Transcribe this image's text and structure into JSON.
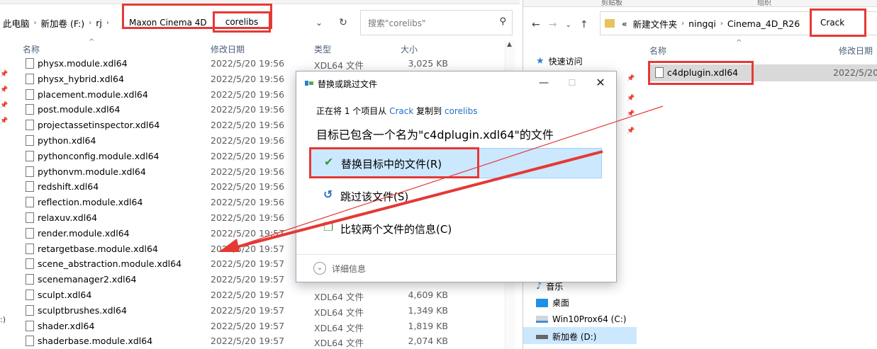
{
  "left_explorer": {
    "breadcrumb": [
      "此电脑",
      "新加卷 (F:)",
      "rj",
      "Maxon Cinema 4D",
      "corelibs"
    ],
    "search_placeholder": "搜索\"corelibs\"",
    "columns": {
      "name": "名称",
      "date": "修改日期",
      "type": "类型",
      "size": "大小"
    },
    "files": [
      {
        "name": "physx.module.xdl64",
        "date": "2022/5/20 19:56",
        "type": "XDL64 文件",
        "size": "3,025 KB"
      },
      {
        "name": "physx_hybrid.xdl64",
        "date": "2022/5/20 19:56",
        "type": "",
        "size": ""
      },
      {
        "name": "placement.module.xdl64",
        "date": "2022/5/20 19:56",
        "type": "",
        "size": ""
      },
      {
        "name": "post.module.xdl64",
        "date": "2022/5/20 19:56",
        "type": "",
        "size": ""
      },
      {
        "name": "projectassetinspector.xdl64",
        "date": "2022/5/20 19:56",
        "type": "",
        "size": ""
      },
      {
        "name": "python.xdl64",
        "date": "2022/5/20 19:56",
        "type": "",
        "size": ""
      },
      {
        "name": "pythonconfig.module.xdl64",
        "date": "2022/5/20 19:56",
        "type": "",
        "size": ""
      },
      {
        "name": "pythonvm.module.xdl64",
        "date": "2022/5/20 19:56",
        "type": "",
        "size": ""
      },
      {
        "name": "redshift.xdl64",
        "date": "2022/5/20 19:56",
        "type": "",
        "size": ""
      },
      {
        "name": "reflection.module.xdl64",
        "date": "2022/5/20 19:56",
        "type": "",
        "size": ""
      },
      {
        "name": "relaxuv.xdl64",
        "date": "2022/5/20 19:56",
        "type": "",
        "size": ""
      },
      {
        "name": "render.module.xdl64",
        "date": "2022/5/20 19:57",
        "type": "",
        "size": ""
      },
      {
        "name": "retargetbase.module.xdl64",
        "date": "2022/5/20 19:57",
        "type": "",
        "size": ""
      },
      {
        "name": "scene_abstraction.module.xdl64",
        "date": "2022/5/20 19:57",
        "type": "",
        "size": ""
      },
      {
        "name": "scenemanager2.xdl64",
        "date": "2022/5/20 19:57",
        "type": "",
        "size": ""
      },
      {
        "name": "sculpt.xdl64",
        "date": "2022/5/20 19:57",
        "type": "XDL64 文件",
        "size": "4,609 KB"
      },
      {
        "name": "sculptbrushes.xdl64",
        "date": "2022/5/20 19:57",
        "type": "XDL64 文件",
        "size": "1,349 KB"
      },
      {
        "name": "shader.xdl64",
        "date": "2022/5/20 19:57",
        "type": "XDL64 文件",
        "size": "1,819 KB"
      },
      {
        "name": "shaderbase.module.xdl64",
        "date": "2022/5/20 19:57",
        "type": "XDL64 文件",
        "size": "2,074 KB"
      }
    ],
    "edge_text": ":)"
  },
  "right_explorer": {
    "ribbon": [
      "剪贴板",
      "组织"
    ],
    "breadcrumb": [
      "«",
      "新建文件夹",
      "ningqi",
      "Cinema_4D_R26",
      "Crack"
    ],
    "columns": {
      "name": "名称",
      "date": "修改日期"
    },
    "nav": {
      "quick_access": "快速访问",
      "music": "音乐",
      "desktop": "桌面",
      "drive_c": "Win10Prox64 (C:)",
      "drive_d": "新加卷 (D:)"
    },
    "file": {
      "name": "c4dplugin.xdl64",
      "date": "2022/5/20"
    }
  },
  "dialog": {
    "title": "替换或跳过文件",
    "copy_prefix": "正在将 1 个项目从 ",
    "copy_source": "Crack",
    "copy_mid": " 复制到 ",
    "copy_target": "corelibs",
    "headline": "目标已包含一个名为\"c4dplugin.xdl64\"的文件",
    "option_replace": "替换目标中的文件(R)",
    "option_skip": "跳过该文件(S)",
    "option_compare": "比较两个文件的信息(C)",
    "details": "详细信息"
  },
  "colors": {
    "highlight_red": "#e53935",
    "selection_blue": "#cce8ff",
    "link_blue": "#1f6fc5"
  }
}
